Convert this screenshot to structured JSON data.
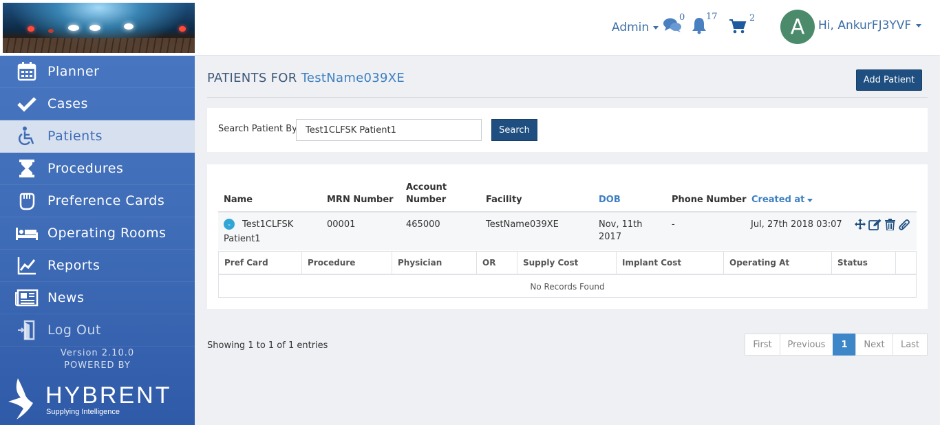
{
  "sidebar": {
    "items": [
      {
        "label": "Planner",
        "icon": "calendar-icon"
      },
      {
        "label": "Cases",
        "icon": "checkmark-icon"
      },
      {
        "label": "Patients",
        "icon": "wheelchair-icon",
        "active": true
      },
      {
        "label": "Procedures",
        "icon": "hourglass-icon"
      },
      {
        "label": "Preference Cards",
        "icon": "hand-icon"
      },
      {
        "label": "Operating Rooms",
        "icon": "bed-icon"
      },
      {
        "label": "Reports",
        "icon": "line-chart-icon"
      },
      {
        "label": "News",
        "icon": "newspaper-icon"
      },
      {
        "label": "Log Out",
        "icon": "logout-door-icon"
      }
    ],
    "version": "Version 2.10.0",
    "powered_by": "POWERED BY",
    "brand_name": "HYBRENT",
    "brand_tagline": "Supplying Intelligence"
  },
  "header": {
    "role": "Admin",
    "messages_count": "0",
    "notifications_count": "17",
    "cart_count": "2",
    "avatar_initial": "A",
    "greeting": "Hi, AnkurFJ3YVF"
  },
  "main": {
    "title_prefix": "PATIENTS FOR",
    "facility": "TestName039XE",
    "add_button": "Add Patient",
    "search": {
      "label": "Search Patient By",
      "value": "Test1CLFSK Patient1",
      "button": "Search"
    },
    "table": {
      "headers": {
        "name": "Name",
        "mrn": "MRN Number",
        "account_line1": "Account",
        "account_line2": "Number",
        "facility": "Facility",
        "dob": "DOB",
        "phone": "Phone Number",
        "created": "Created at"
      },
      "rows": [
        {
          "toggle": "-",
          "name_line1": "Test1CLFSK",
          "name_line2": "Patient1",
          "mrn": "00001",
          "account": "465000",
          "facility": "TestName039XE",
          "dob_line1": "Nov, 11th",
          "dob_line2": "2017",
          "phone": "-",
          "created": "Jul, 27th 2018 03:07"
        }
      ],
      "sub_headers": [
        "Pref Card",
        "Procedure",
        "Physician",
        "OR",
        "Supply Cost",
        "Implant Cost",
        "Operating At",
        "Status"
      ],
      "no_records": "No Records Found"
    },
    "showing": "Showing 1 to 1 of 1 entries",
    "pagination": {
      "first": "First",
      "previous": "Previous",
      "current": "1",
      "next": "Next",
      "last": "Last"
    }
  },
  "colors": {
    "sidebar_blue": "#4a78c2",
    "primary_button": "#1e4f80",
    "link_blue": "#3d7fc1",
    "active_page": "#3d86c8",
    "avatar_green": "#4b8a6b"
  }
}
